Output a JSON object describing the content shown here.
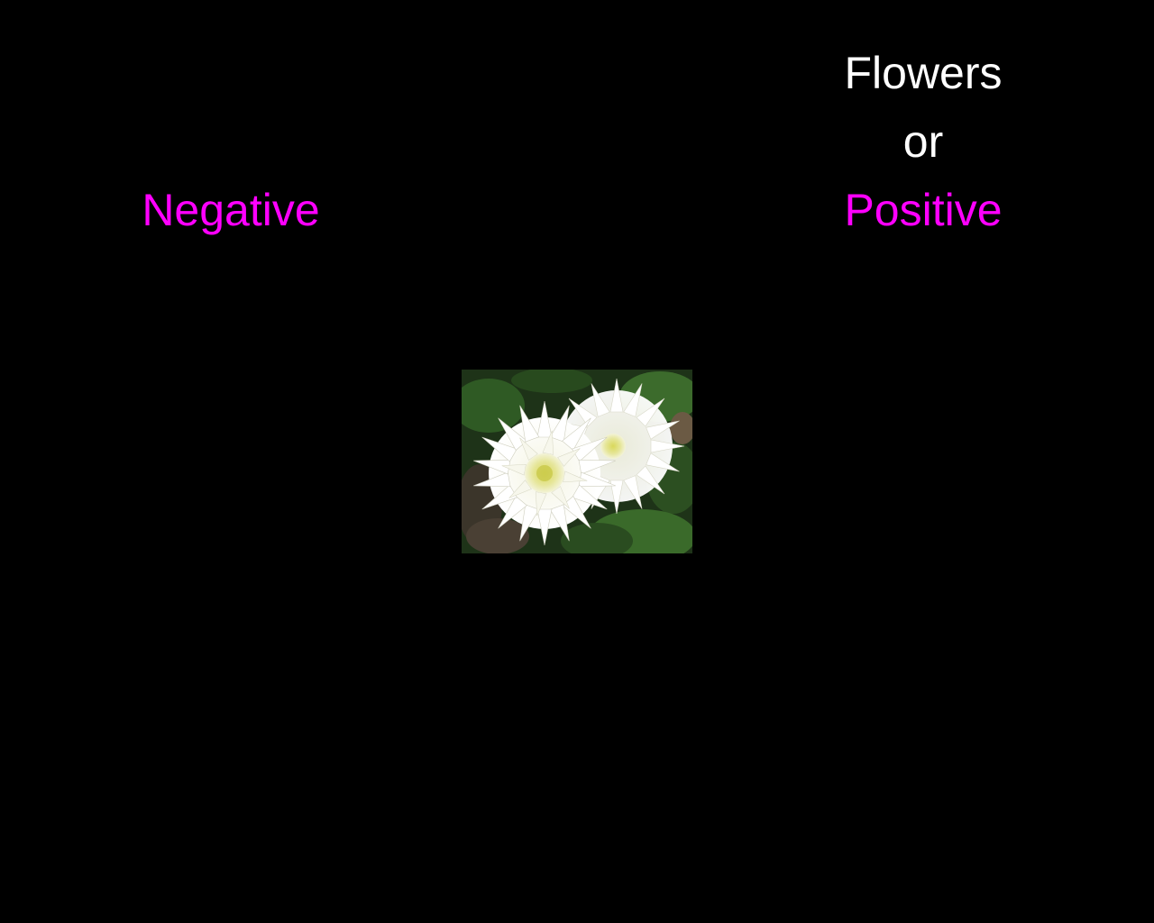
{
  "left_category": {
    "label": "Negative",
    "color": "#ff00ff"
  },
  "right_category": {
    "top_label": "Flowers",
    "connector": "or",
    "bottom_label": "Positive",
    "top_color": "#ffffff",
    "bottom_color": "#ff00ff"
  },
  "stimulus": {
    "icon": "white-dahlia-flowers-photo"
  },
  "colors": {
    "background": "#000000",
    "text_white": "#ffffff",
    "accent_magenta": "#ff00ff"
  }
}
